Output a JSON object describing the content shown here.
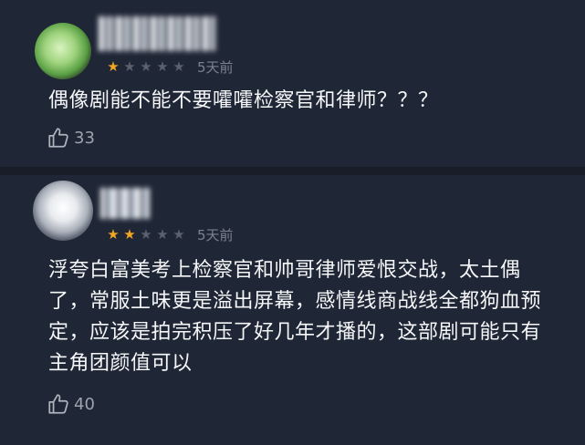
{
  "reviews": [
    {
      "rating": 1,
      "max_rating": 5,
      "time": "5天前",
      "comment": "偶像剧能不能不要嚯嚯检察官和律师？？？",
      "likes": "33"
    },
    {
      "rating": 2,
      "max_rating": 5,
      "time": "5天前",
      "comment": "浮夸白富美考上检察官和帅哥律师爱恨交战，太土偶了，常服土味更是溢出屏幕，感情线商战线全都狗血预定，应该是拍完积压了好几年才播的，这部剧可能只有主角团颜值可以",
      "likes": "40"
    }
  ],
  "colors": {
    "background": "#1f2635",
    "star_on": "#f4a623",
    "star_off": "#5a606c",
    "meta_text": "#7b818d"
  },
  "icons": {
    "like": "thumbs-up-icon",
    "star": "star-icon"
  }
}
